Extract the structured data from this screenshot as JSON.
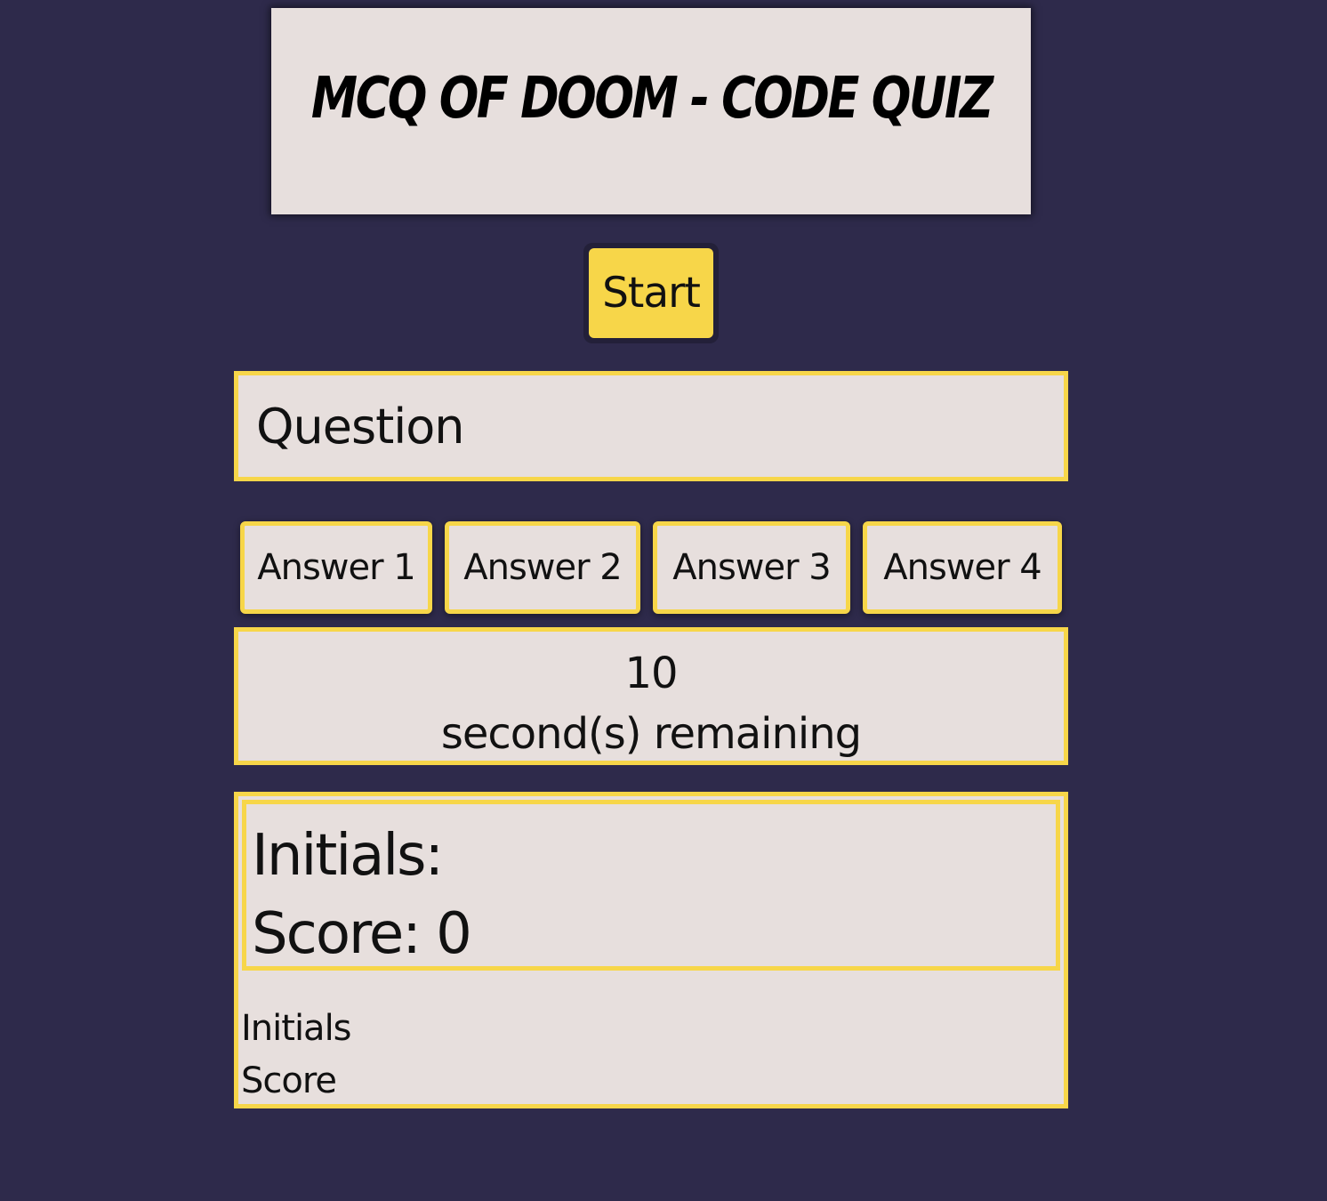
{
  "header": {
    "title": "MCQ of Doom - Code Quiz"
  },
  "controls": {
    "start_label": "Start"
  },
  "quiz": {
    "question": "Question",
    "answers": [
      "Answer 1",
      "Answer 2",
      "Answer 3",
      "Answer 4"
    ]
  },
  "timer": {
    "seconds": "10",
    "label": "second(s) remaining"
  },
  "results": {
    "initials_label": "Initials:",
    "score_text": "Score: 0",
    "scoreboard": {
      "initials_header": "Initials",
      "score_header": "Score"
    }
  },
  "colors": {
    "background": "#2e2a4b",
    "accent": "#f7d649",
    "card": "#e7dfdd"
  }
}
